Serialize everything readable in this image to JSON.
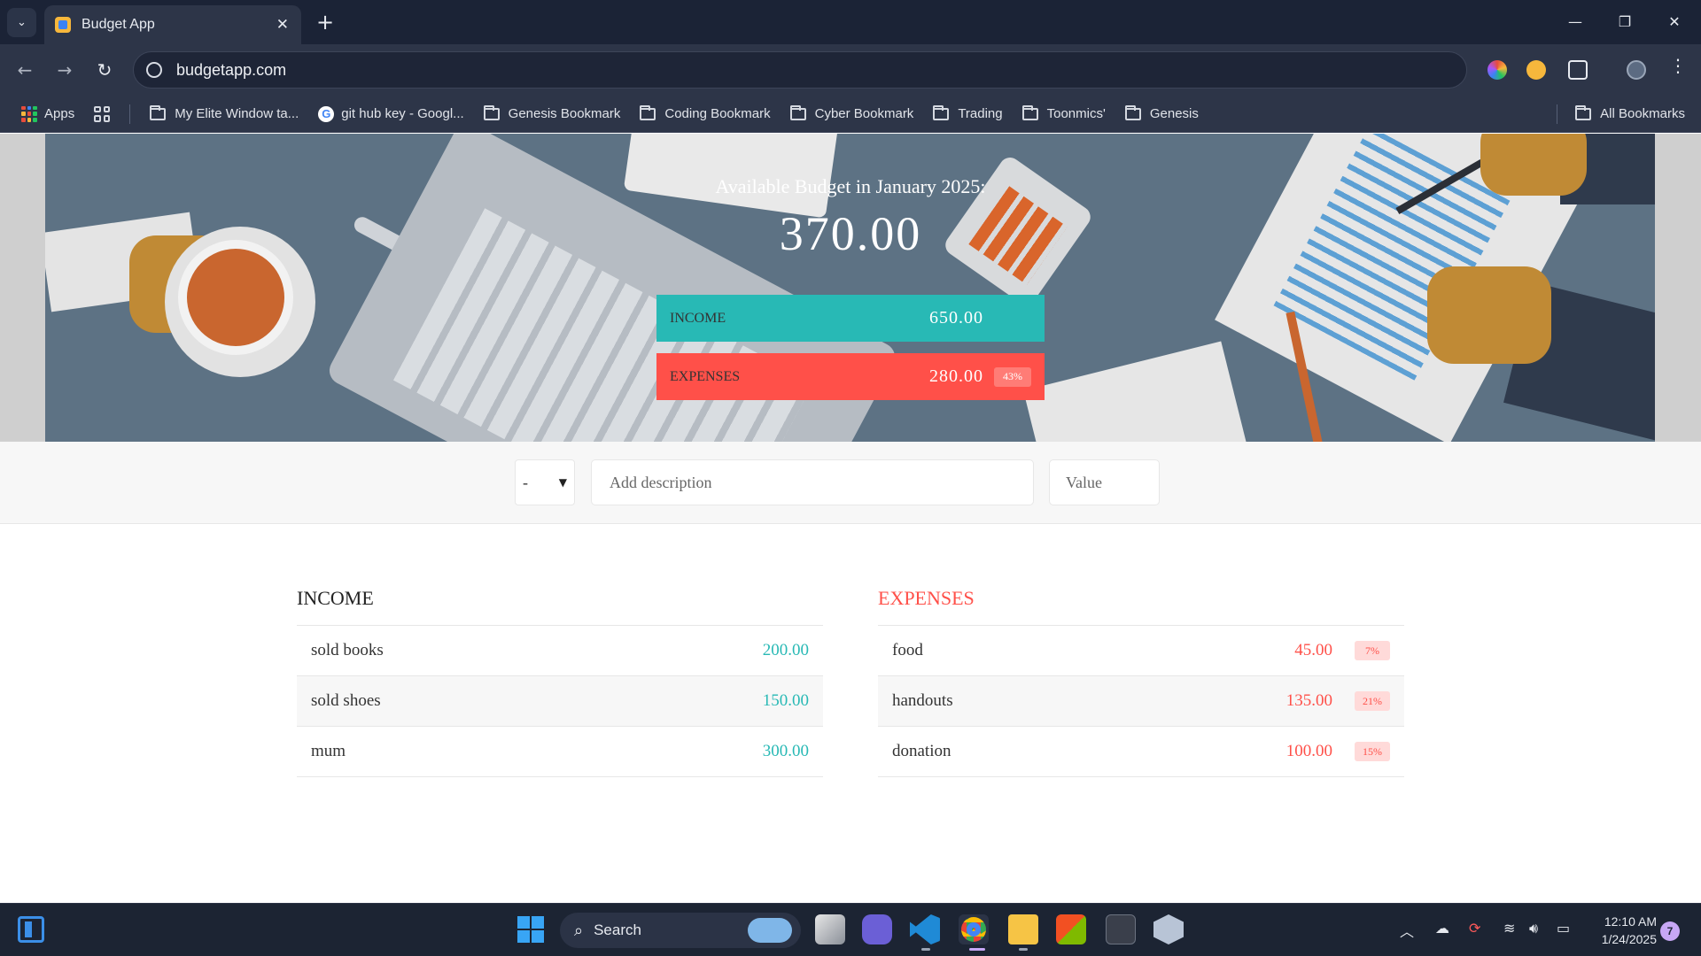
{
  "browser": {
    "tab_title": "Budget App",
    "tab_close": "✕",
    "new_tab": "+",
    "url": "budgetapp.com",
    "bookmarks": {
      "apps": "Apps",
      "items": [
        "My Elite Window ta...",
        "git hub key - Googl...",
        "Genesis Bookmark",
        "Coding Bookmark",
        "Cyber Bookmark",
        "Trading",
        "Toonmics'",
        "Genesis"
      ],
      "all": "All Bookmarks"
    }
  },
  "budget": {
    "title": "Available Budget in January 2025:",
    "value": "370.00",
    "income": {
      "label": "INCOME",
      "value": "650.00",
      "color": "#28b9b5"
    },
    "expenses": {
      "label": "EXPENSES",
      "value": "280.00",
      "percentage": "43%",
      "color": "#ff5049"
    }
  },
  "add": {
    "type_value": "-",
    "description_placeholder": "Add description",
    "value_placeholder": "Value"
  },
  "income": {
    "title": "INCOME",
    "items": [
      {
        "description": "sold books",
        "value": "200.00"
      },
      {
        "description": "sold shoes",
        "value": "150.00"
      },
      {
        "description": "mum",
        "value": "300.00"
      }
    ]
  },
  "expenses": {
    "title": "EXPENSES",
    "items": [
      {
        "description": "food",
        "value": "45.00",
        "percentage": "7%"
      },
      {
        "description": "handouts",
        "value": "135.00",
        "percentage": "21%"
      },
      {
        "description": "donation",
        "value": "100.00",
        "percentage": "15%"
      }
    ]
  },
  "taskbar": {
    "search_label": "Search",
    "time": "12:10 AM",
    "date": "1/24/2025",
    "notifications": "7"
  }
}
